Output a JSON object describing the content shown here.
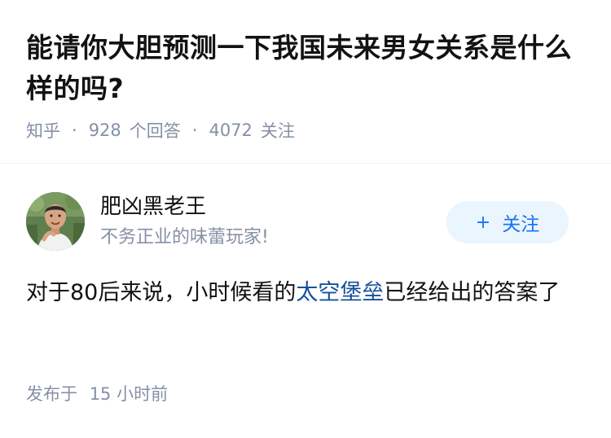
{
  "question": {
    "title": "能请你大胆预测一下我国未来男女关系是什么样的吗?",
    "source": "知乎",
    "answer_count": "928",
    "answer_label": "个回答",
    "follower_count": "4072",
    "follower_label": "关注"
  },
  "author": {
    "name": "肥凶黑老王",
    "bio": "不务正业的味蕾玩家!",
    "avatar_icon": "avatar-photo"
  },
  "follow_button": {
    "plus": "+",
    "label": "关注"
  },
  "answer": {
    "text_before": "对于80后来说，小时候看的",
    "link_text": "太空堡垒",
    "text_after": "已经给出的答案了",
    "time_prefix": "发布于",
    "time_value": "15 小时前"
  },
  "colors": {
    "title": "#121212",
    "meta": "#8590a6",
    "link": "#175199",
    "follow_bg": "#ebf5fd",
    "follow_text": "#1772f6"
  }
}
